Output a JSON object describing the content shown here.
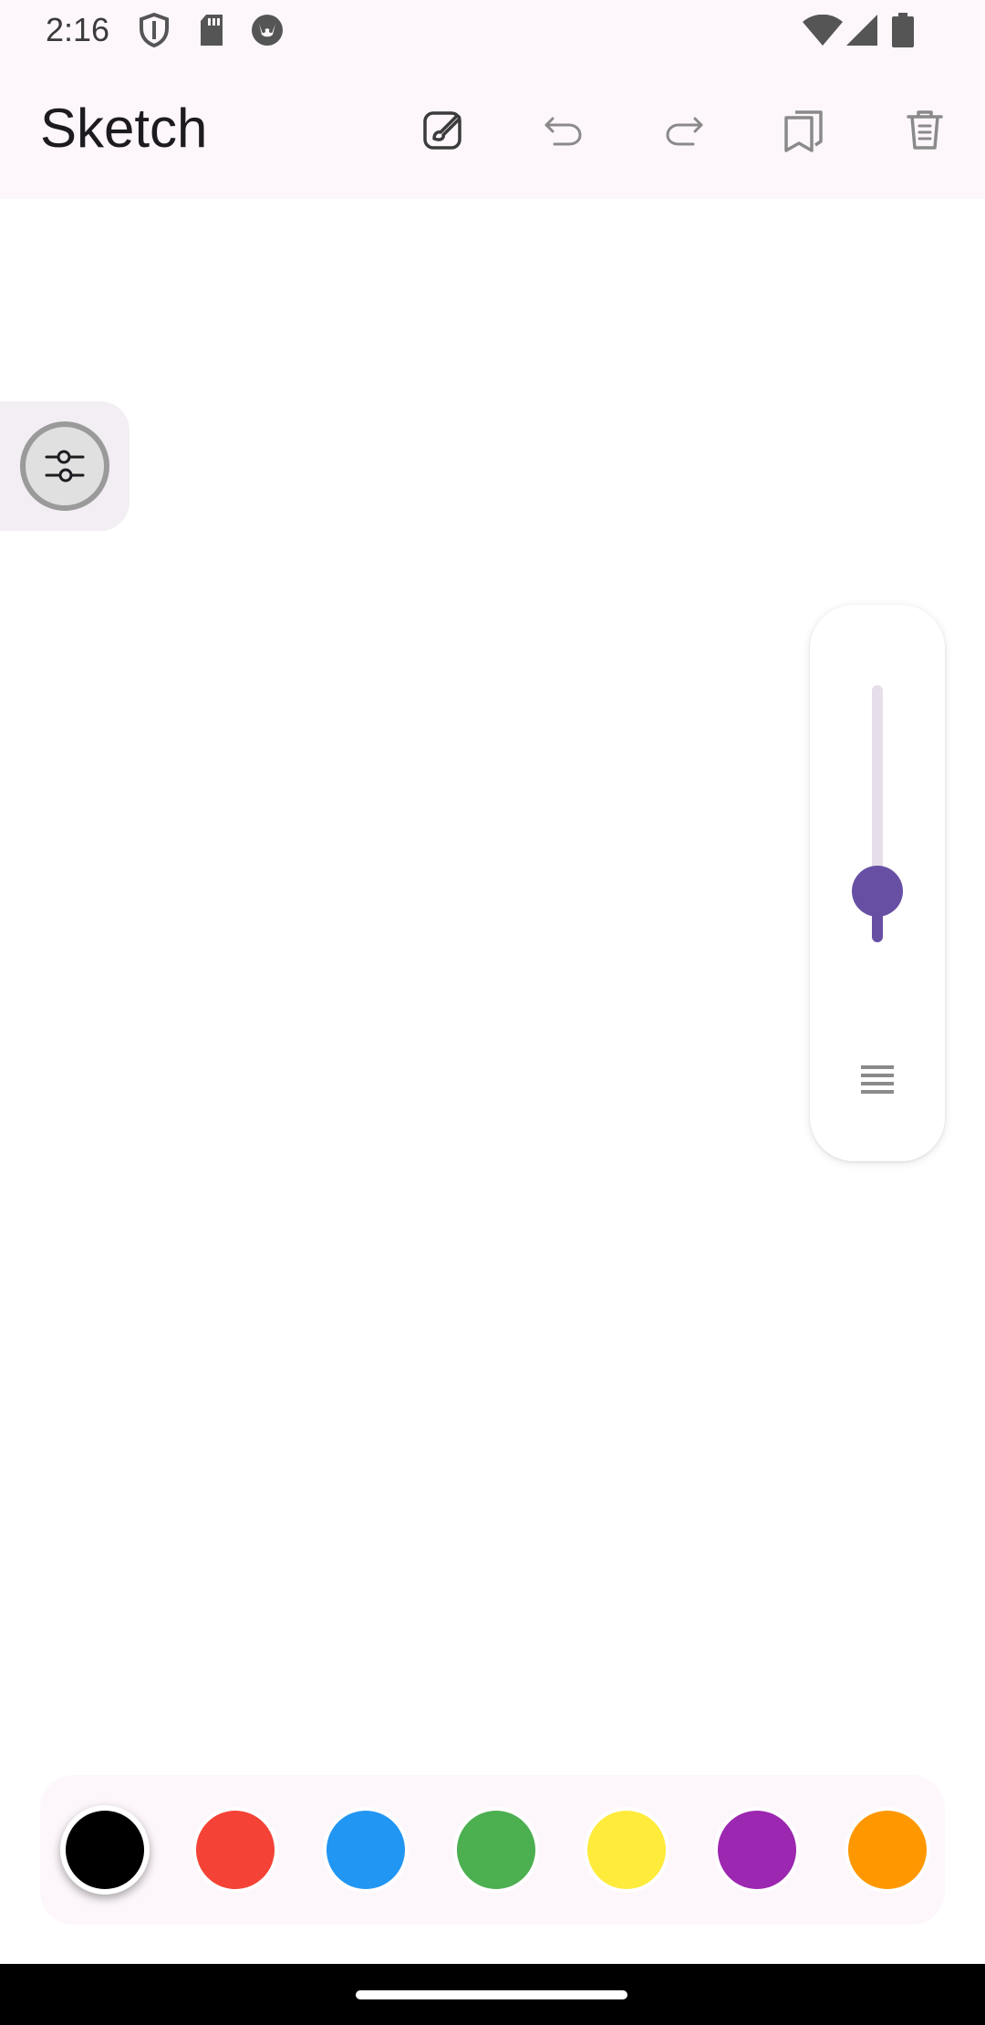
{
  "status_bar": {
    "time": "2:16",
    "icons": [
      "shield-icon",
      "sd-card-icon",
      "cat-face-icon",
      "wifi-icon",
      "cellular-icon",
      "battery-icon"
    ]
  },
  "app_bar": {
    "title": "Sketch",
    "actions": [
      "brush-edit-icon",
      "undo-icon",
      "redo-icon",
      "copy-pages-icon",
      "delete-icon"
    ]
  },
  "side_panel": {
    "icon": "tune-sliders-icon"
  },
  "brush_size_slider": {
    "value_fraction": 0.2,
    "icon": "line-weight-icon",
    "accent": "#6750a4"
  },
  "palette": {
    "selected": "#000000",
    "colors": [
      "#000000",
      "#f44336",
      "#2196f3",
      "#4caf50",
      "#ffeb3b",
      "#9c27b0",
      "#ff9800"
    ]
  }
}
